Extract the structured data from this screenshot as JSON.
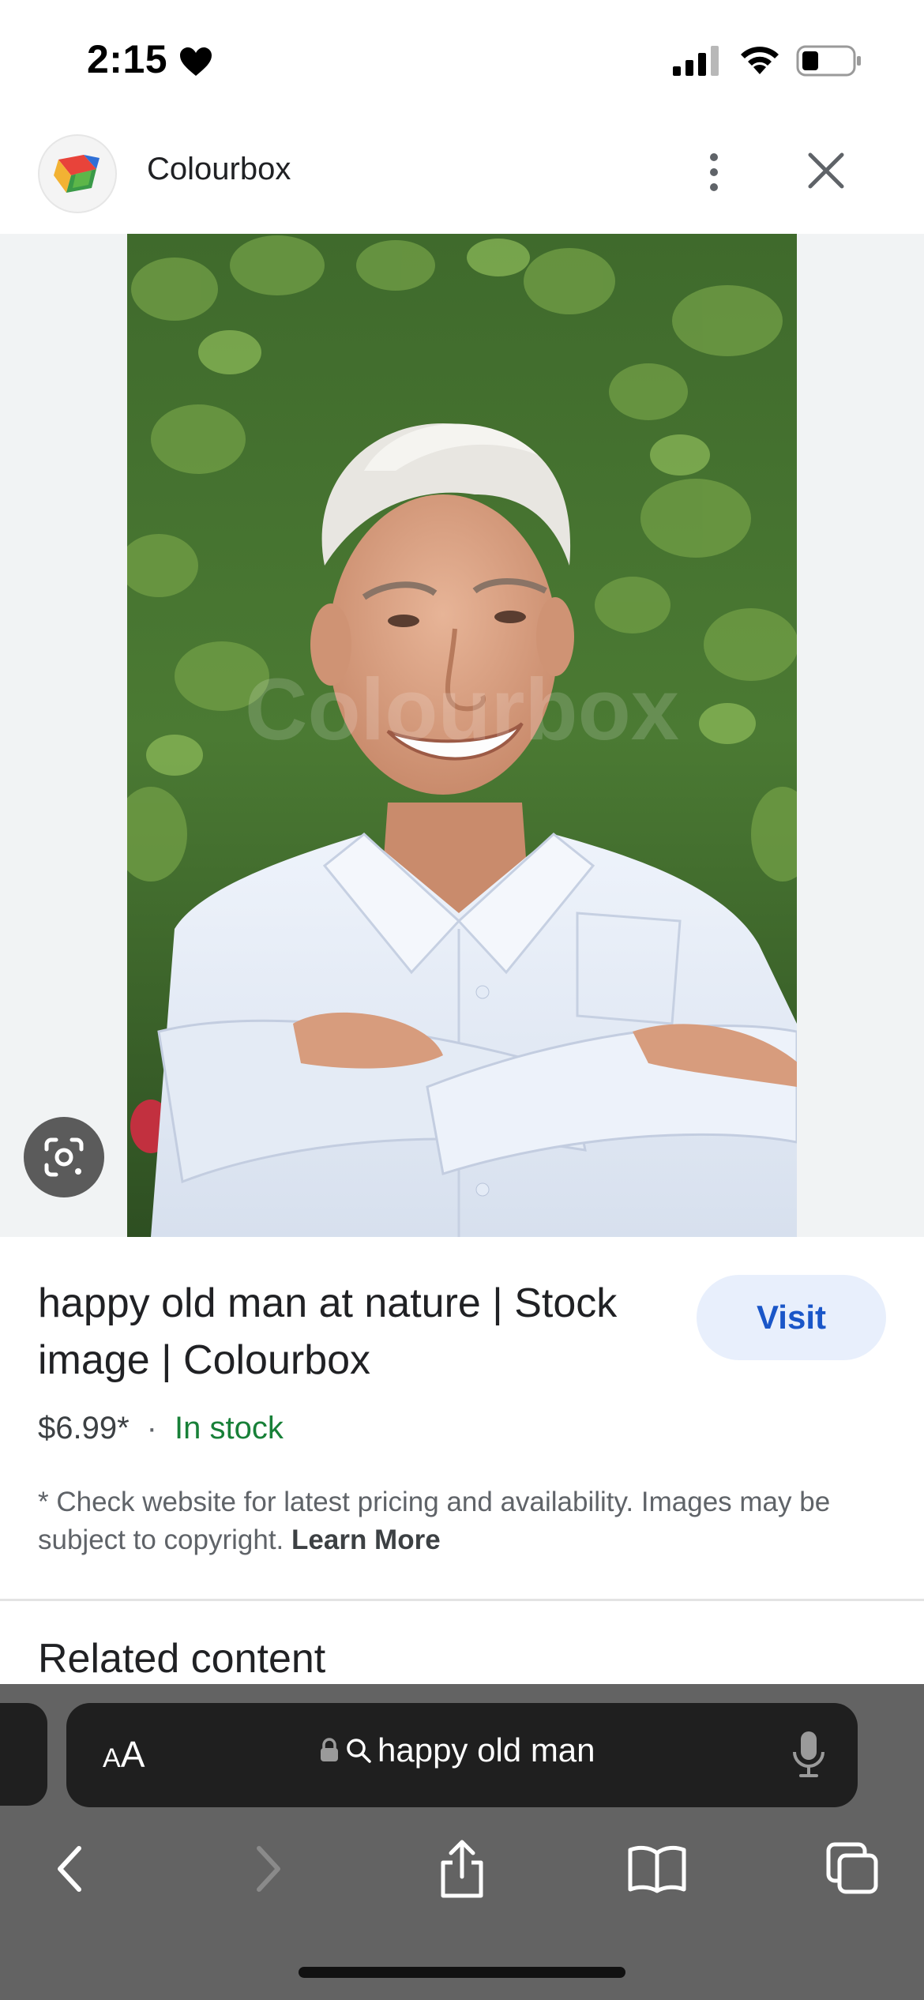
{
  "status_bar": {
    "time": "2:15",
    "icons": [
      "heart-icon",
      "cellular-signal-icon",
      "wifi-icon",
      "battery-icon"
    ]
  },
  "header": {
    "site_name": "Colourbox",
    "logo_icon": "colourbox-logo-icon",
    "more_icon": "more-vertical-icon",
    "close_icon": "close-icon"
  },
  "image": {
    "alt": "happy old man at nature | Stock image | Colourbox",
    "watermark": "Colourbox",
    "lens_icon": "google-lens-icon"
  },
  "result": {
    "title": "happy old man at nature | Stock image | Colourbox",
    "visit_label": "Visit",
    "price": "$6.99*",
    "separator": "·",
    "stock": "In stock",
    "disclaimer": "* Check website for latest pricing and availability. Images may be subject to copyright.",
    "learn_more": "Learn More"
  },
  "related": {
    "heading": "Related content"
  },
  "browser": {
    "aa_small": "A",
    "aa_large": "A",
    "url": "happy old man",
    "icons": [
      "lock-icon",
      "search-icon",
      "microphone-icon",
      "back-icon",
      "forward-icon",
      "share-icon",
      "bookmarks-icon",
      "tabs-icon"
    ]
  },
  "colors": {
    "visit_bg": "#e8effc",
    "visit_text": "#1a56c8",
    "stock_green": "#188038",
    "browser_bar": "#636363",
    "address_bar": "#1f1f1f"
  }
}
